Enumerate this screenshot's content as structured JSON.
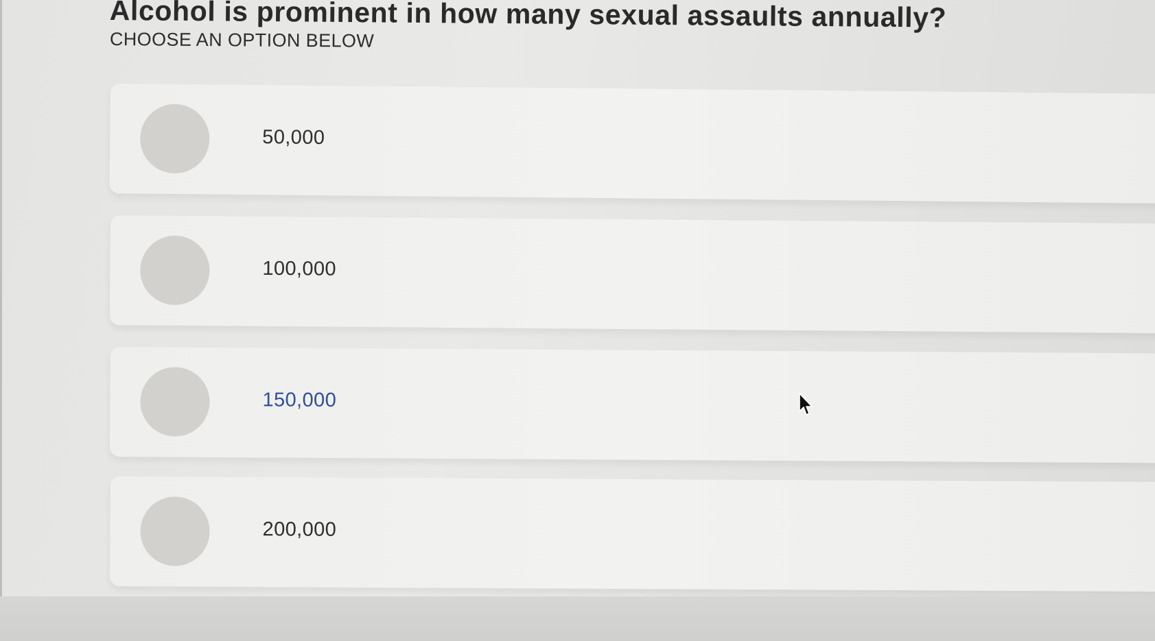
{
  "question": {
    "title": "Alcohol is prominent in how many sexual assaults annually?",
    "subtitle": "CHOOSE AN OPTION BELOW"
  },
  "options": [
    {
      "label": "50,000"
    },
    {
      "label": "100,000"
    },
    {
      "label": "150,000"
    },
    {
      "label": "200,000"
    }
  ],
  "colors": {
    "radio_fill": "#d3d1cd",
    "hover_text": "#2f4f9a",
    "card_bg": "#f0f0ee"
  },
  "icons": {
    "radio": "radio-circle-icon",
    "cursor": "mouse-pointer-icon"
  }
}
